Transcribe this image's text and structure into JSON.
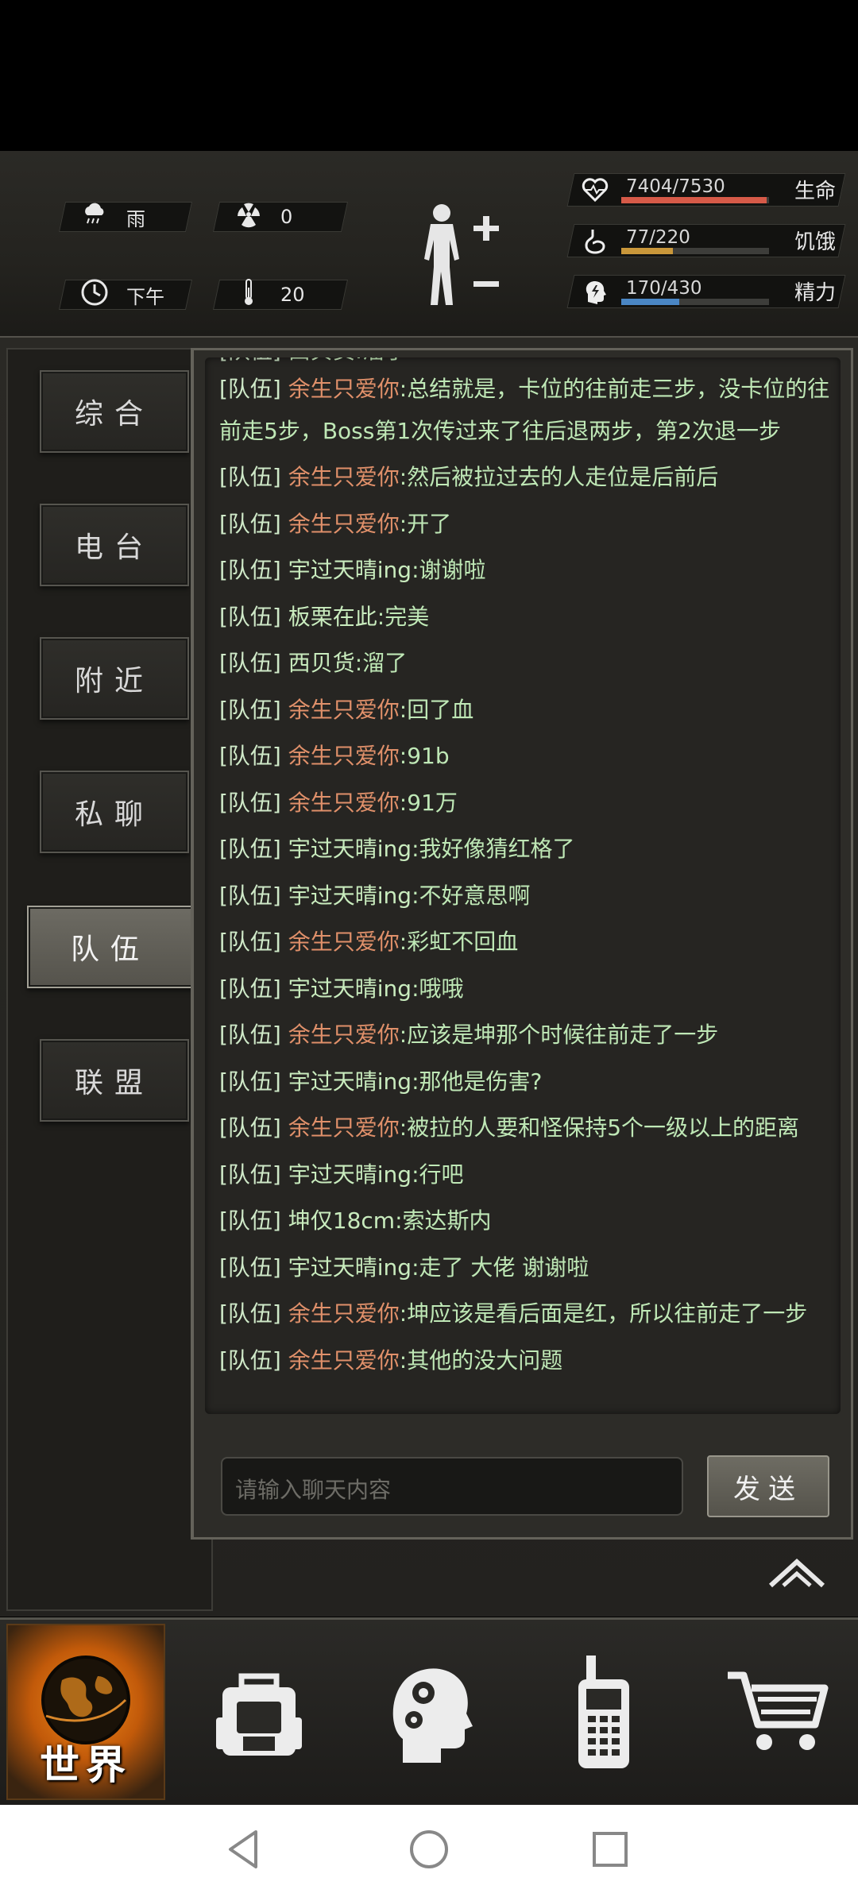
{
  "status": {
    "weather": "雨",
    "radiation": "0",
    "time_of_day": "下午",
    "temperature": "20"
  },
  "bars": [
    {
      "value": "7404/7530",
      "label": "生命",
      "fraction": 0.983,
      "color": "#d65a48"
    },
    {
      "value": "77/220",
      "label": "饥饿",
      "fraction": 0.35,
      "color": "#c9973a"
    },
    {
      "value": "170/430",
      "label": "精力",
      "fraction": 0.395,
      "color": "#4a86c4"
    }
  ],
  "tabs": [
    {
      "label": "综合",
      "active": false
    },
    {
      "label": "电台",
      "active": false
    },
    {
      "label": "附近",
      "active": false
    },
    {
      "label": "私聊",
      "active": false
    },
    {
      "label": "队伍",
      "active": true
    },
    {
      "label": "联盟",
      "active": false
    }
  ],
  "messages": [
    {
      "channel": "[队伍]",
      "nick": "西贝货",
      "color": "green",
      "text": ":溜了",
      "partial": true
    },
    {
      "channel": "[队伍]",
      "nick": "余生只爱你",
      "color": "orange",
      "text": ":总结就是，卡位的往前走三步，没卡位的往前走5步，Boss第1次传过来了往后退两步，第2次退一步",
      "wrap": true
    },
    {
      "channel": "[队伍]",
      "nick": "余生只爱你",
      "color": "orange",
      "text": ":然后被拉过去的人走位是后前后"
    },
    {
      "channel": "[队伍]",
      "nick": "余生只爱你",
      "color": "orange",
      "text": ":开了"
    },
    {
      "channel": "[队伍]",
      "nick": "宇过天晴ing",
      "color": "green",
      "text": ":谢谢啦"
    },
    {
      "channel": "[队伍]",
      "nick": "板栗在此",
      "color": "green",
      "text": ":完美"
    },
    {
      "channel": "[队伍]",
      "nick": "西贝货",
      "color": "green",
      "text": ":溜了"
    },
    {
      "channel": "[队伍]",
      "nick": "余生只爱你",
      "color": "orange",
      "text": ":回了血"
    },
    {
      "channel": "[队伍]",
      "nick": "余生只爱你",
      "color": "orange",
      "text": ":91b"
    },
    {
      "channel": "[队伍]",
      "nick": "余生只爱你",
      "color": "orange",
      "text": ":91万"
    },
    {
      "channel": "[队伍]",
      "nick": "宇过天晴ing",
      "color": "green",
      "text": ":我好像猜红格了"
    },
    {
      "channel": "[队伍]",
      "nick": "宇过天晴ing",
      "color": "green",
      "text": ":不好意思啊"
    },
    {
      "channel": "[队伍]",
      "nick": "余生只爱你",
      "color": "orange",
      "text": ":彩虹不回血"
    },
    {
      "channel": "[队伍]",
      "nick": "宇过天晴ing",
      "color": "green",
      "text": ":哦哦"
    },
    {
      "channel": "[队伍]",
      "nick": "余生只爱你",
      "color": "orange",
      "text": ":应该是坤那个时候往前走了一步"
    },
    {
      "channel": "[队伍]",
      "nick": "宇过天晴ing",
      "color": "green",
      "text": ":那他是伤害?"
    },
    {
      "channel": "[队伍]",
      "nick": "余生只爱你",
      "color": "orange",
      "text": ":被拉的人要和怪保持5个一级以上的距离"
    },
    {
      "channel": "[队伍]",
      "nick": "宇过天晴ing",
      "color": "green",
      "text": ":行吧"
    },
    {
      "channel": "[队伍]",
      "nick": "坤仅18cm",
      "color": "green",
      "text": ":索达斯内"
    },
    {
      "channel": "[队伍]",
      "nick": "宇过天晴ing",
      "color": "green",
      "text": ":走了 大佬 谢谢啦"
    },
    {
      "channel": "[队伍]",
      "nick": "余生只爱你",
      "color": "orange",
      "text": ":坤应该是看后面是红，所以往前走了一步"
    },
    {
      "channel": "[队伍]",
      "nick": "余生只爱你",
      "color": "orange",
      "text": ":其他的没大问题"
    }
  ],
  "input": {
    "placeholder": "请输入聊天内容"
  },
  "send_label": "发送",
  "nav": {
    "world_label": "世界",
    "items": [
      "globe-icon",
      "backpack-icon",
      "skills-head-icon",
      "radio-icon",
      "cart-icon"
    ]
  },
  "icons": {
    "weather": "rain-cloud-icon",
    "radiation": "radiation-icon",
    "time": "clock-icon",
    "temperature": "thermometer-icon",
    "health": "heart-pulse-icon",
    "hunger": "stomach-icon",
    "energy": "energy-head-icon"
  }
}
